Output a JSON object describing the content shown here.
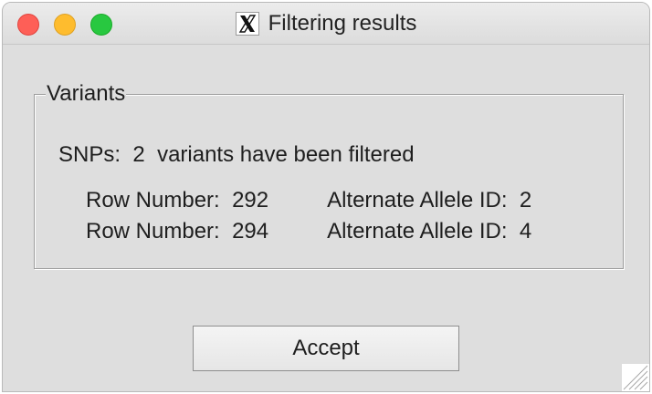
{
  "window": {
    "title": "Filtering results",
    "title_icon": "x11-app-icon"
  },
  "groupbox": {
    "label": "Variants"
  },
  "summary": {
    "label": "SNPs:",
    "count": "2",
    "text": "variants have been filtered"
  },
  "rows": [
    {
      "row_label": "Row Number:",
      "row_value": "292",
      "allele_label": "Alternate Allele ID:",
      "allele_value": "2"
    },
    {
      "row_label": "Row Number:",
      "row_value": "294",
      "allele_label": "Alternate Allele ID:",
      "allele_value": "4"
    }
  ],
  "buttons": {
    "accept_label": "Accept"
  },
  "colors": {
    "close": "#fe5f57",
    "minimize": "#febc2e",
    "maximize": "#28c840",
    "window_bg": "#dedede"
  }
}
